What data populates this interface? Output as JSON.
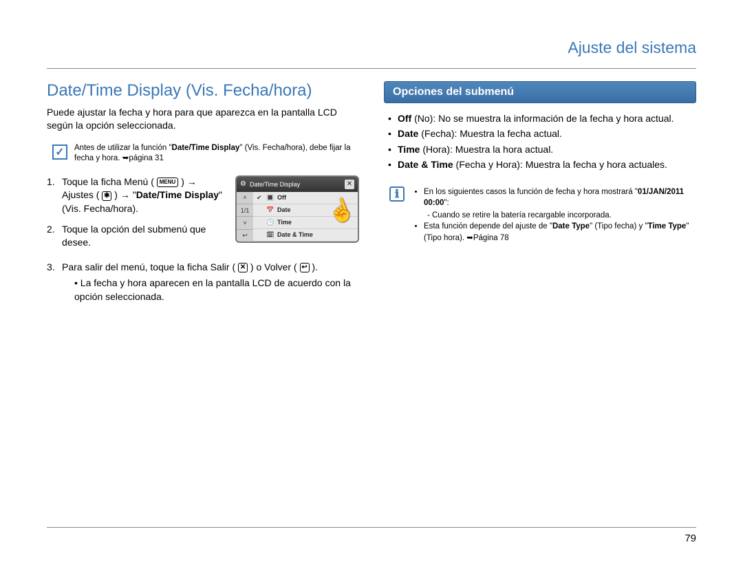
{
  "header": {
    "title": "Ajuste del sistema"
  },
  "pageNumber": "79",
  "left": {
    "title": "Date/Time Display (Vis. Fecha/hora)",
    "intro": "Puede ajustar la fecha y hora para que aparezca en la pantalla LCD según la opción seleccionada.",
    "note": {
      "pre": "Antes de utilizar la función \"",
      "bold": "Date/Time Display",
      "mid": "\" (Vis. Fecha/hora), debe fijar la fecha y hora. ",
      "page": "➥página 31"
    },
    "icons": {
      "menu_label": "MENU",
      "gear_glyph": "✱",
      "exit_glyph": "✕",
      "back_glyph": "↩"
    },
    "steps": {
      "s1": {
        "a": "Toque la ficha Menú (",
        "b": ") ",
        "c": "Ajustes (",
        "d": ") ",
        "e": " \"",
        "bold": "Date/Time Display",
        "f": "\" (Vis. Fecha/hora)."
      },
      "s2": "Toque la opción del submenú que desee.",
      "s3": {
        "a": "Para salir del menú, toque la ficha Salir (",
        "b": ") o Volver (",
        "c": ").",
        "sub": "La fecha y hora aparecen en la pantalla LCD de acuerdo con la opción seleccionada."
      }
    },
    "device": {
      "title": "Date/Time Display",
      "pager": "1/1",
      "options": {
        "off": "Off",
        "date": "Date",
        "time": "Time",
        "datetime": "Date & Time"
      }
    }
  },
  "right": {
    "submenuTitle": "Opciones del submenú",
    "options": {
      "off": {
        "bold": "Off",
        "paren": " (No): ",
        "rest": "No se muestra la información de la fecha y hora actual."
      },
      "date": {
        "bold": "Date",
        "paren": " (Fecha): ",
        "rest": "Muestra la fecha actual."
      },
      "time": {
        "bold": "Time",
        "paren": " (Hora): ",
        "rest": "Muestra la hora actual."
      },
      "datetime": {
        "bold": "Date & Time",
        "paren": " (Fecha y Hora): ",
        "rest": "Muestra la fecha y hora actuales."
      }
    },
    "note2": {
      "line1a": "En los siguientes casos la función de fecha y hora mostrará \"",
      "line1b": "01/JAN/2011 00:00",
      "line1c": "\":",
      "sub1": "Cuando se retire la batería recargable incorporada.",
      "line2a": "Esta función depende del ajuste de \"",
      "line2b": "Date Type",
      "line2c": "\" (Tipo fecha) y \"",
      "line2d": "Time Type",
      "line2e": "\" (Tipo hora). ",
      "line2f": "➥Página 78"
    }
  }
}
